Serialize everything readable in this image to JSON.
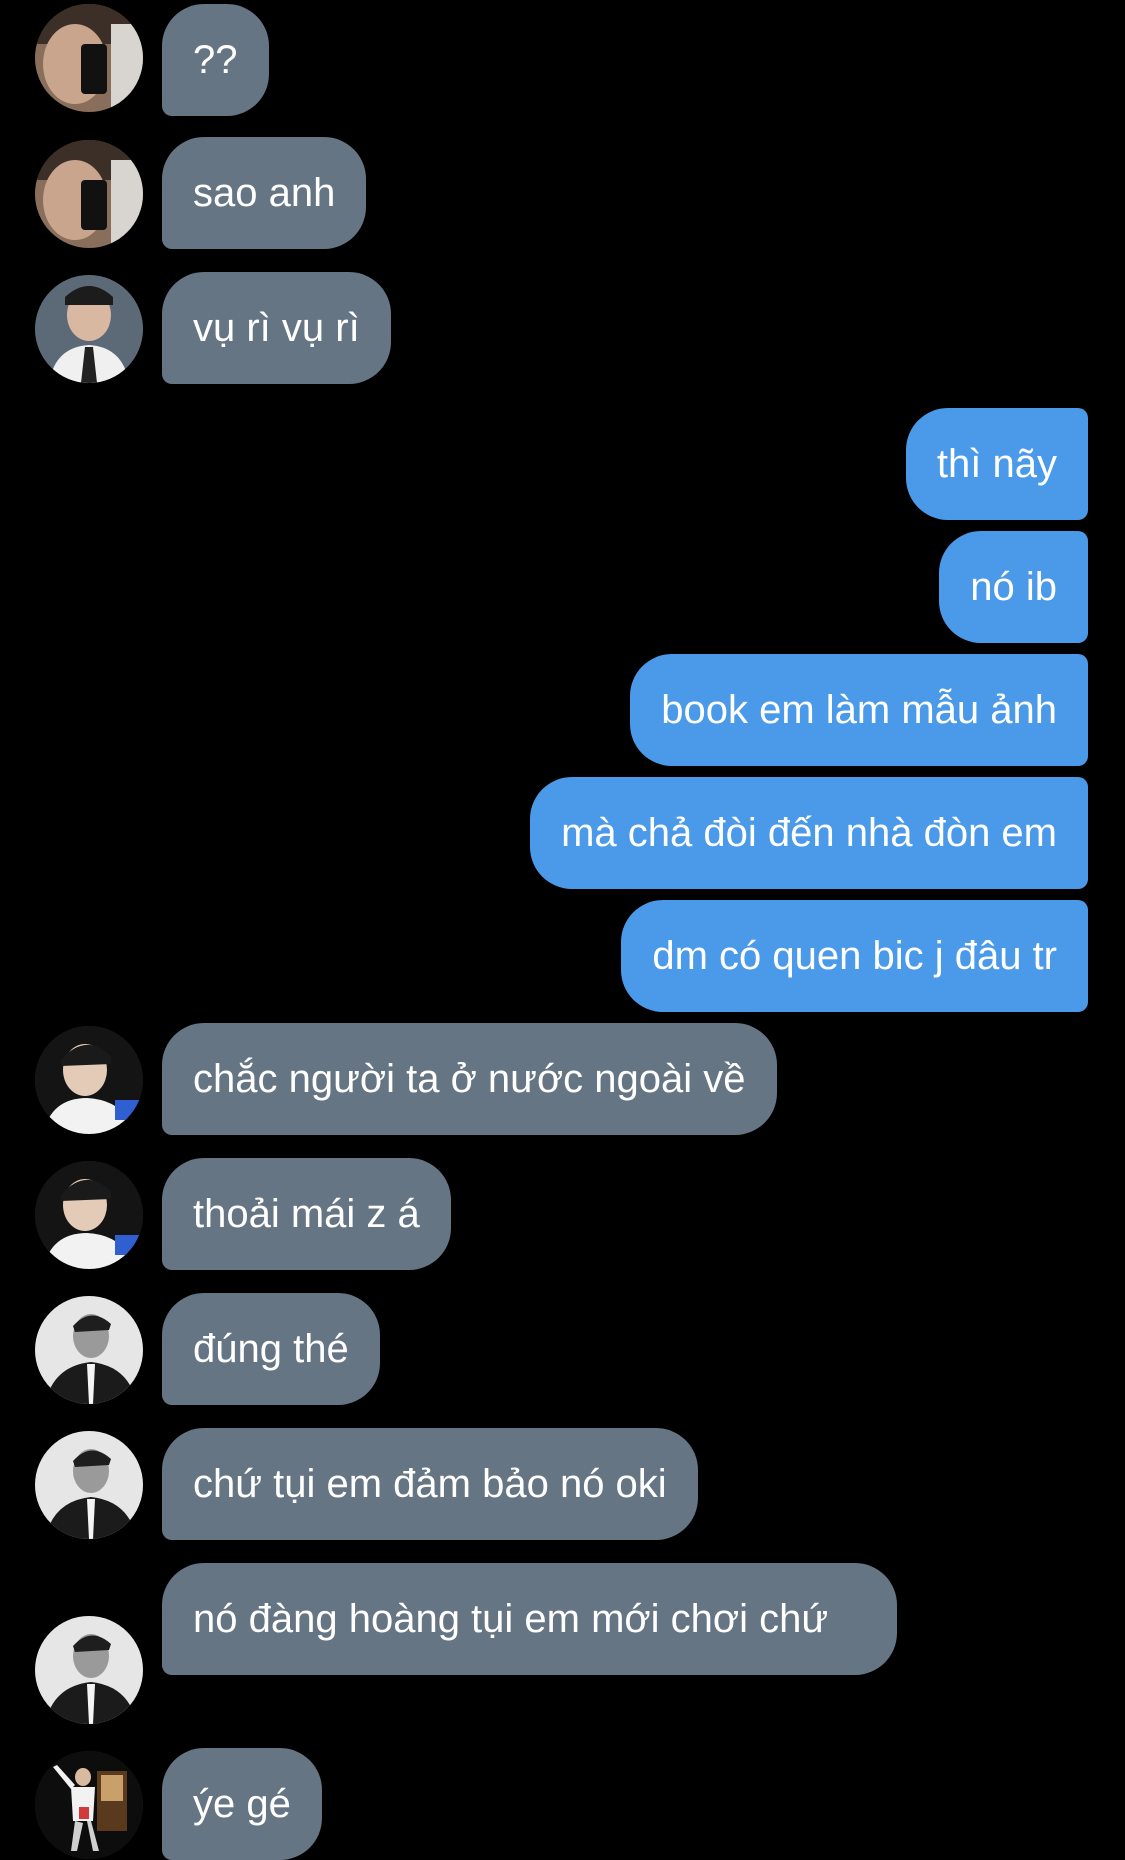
{
  "colors": {
    "background": "#000000",
    "incoming_bubble": "#667583",
    "outgoing_bubble": "#4a9ae9",
    "text": "#ffffff"
  },
  "messages": [
    {
      "direction": "incoming",
      "avatar": "avatar-a",
      "text": "??"
    },
    {
      "direction": "incoming",
      "avatar": "avatar-a",
      "text": "sao anh"
    },
    {
      "direction": "incoming",
      "avatar": "avatar-b",
      "text": "vụ rì vụ rì"
    },
    {
      "direction": "outgoing",
      "text": "thì nãy"
    },
    {
      "direction": "outgoing",
      "text": "nó ib"
    },
    {
      "direction": "outgoing",
      "text": "book em làm mẫu ảnh"
    },
    {
      "direction": "outgoing",
      "text": "mà chả đòi đến nhà đòn em"
    },
    {
      "direction": "outgoing",
      "text": "dm có quen bic j đâu tr"
    },
    {
      "direction": "incoming",
      "avatar": "avatar-c",
      "text": "chắc người ta ở nước ngoài về"
    },
    {
      "direction": "incoming",
      "avatar": "avatar-c",
      "text": "thoải mái z á"
    },
    {
      "direction": "incoming",
      "avatar": "avatar-d",
      "text": "đúng thé"
    },
    {
      "direction": "incoming",
      "avatar": "avatar-d",
      "text": "chứ tụi em đảm bảo nó oki"
    },
    {
      "direction": "incoming",
      "avatar": "avatar-d",
      "text": "nó đàng hoàng tụi em mới chơi chứ"
    },
    {
      "direction": "incoming",
      "avatar": "avatar-e",
      "text": "ýe gé"
    }
  ]
}
